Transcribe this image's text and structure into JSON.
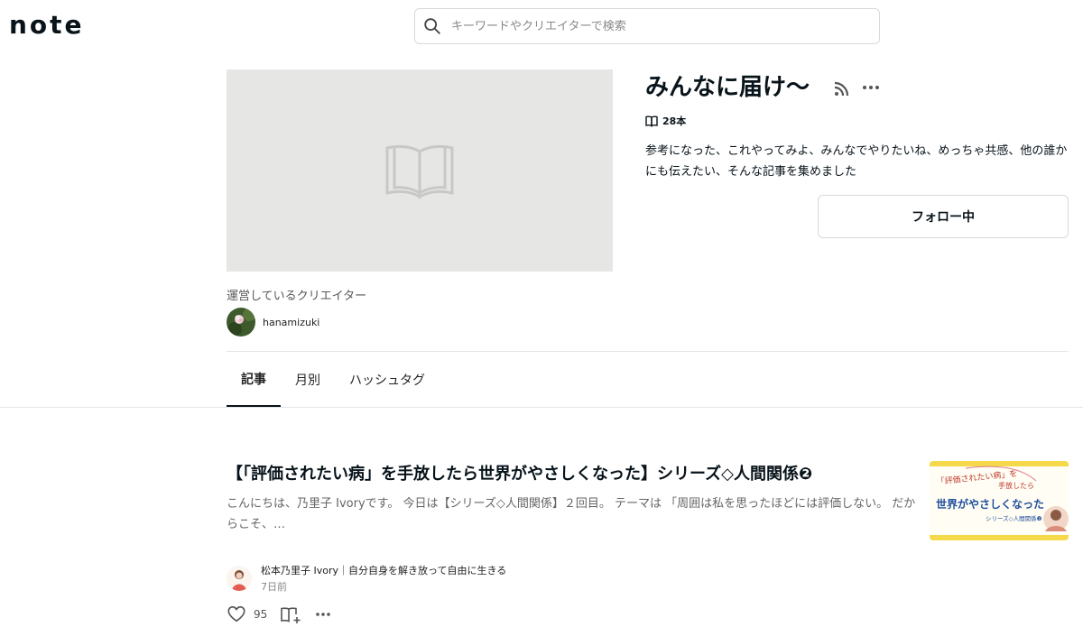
{
  "header": {
    "logo": "note",
    "search_placeholder": "キーワードやクリエイターで検索"
  },
  "magazine": {
    "title": "みんなに届け〜",
    "count": "28本",
    "description": "参考になった、これやってみよ、みんなでやりたいね、めっちゃ共感、他の誰かにも伝えたい、そんな記事を集めました",
    "follow_label": "フォロー中",
    "creators_label": "運営しているクリエイター",
    "creator_name": "hanamizuki"
  },
  "tabs": [
    {
      "label": "記事",
      "active": true
    },
    {
      "label": "月別",
      "active": false
    },
    {
      "label": "ハッシュタグ",
      "active": false
    }
  ],
  "article": {
    "title": "【「評価されたい病」を手放したら世界がやさしくなった】シリーズ◇人間関係❷",
    "excerpt": "こんにちは、乃里子 Ivoryです。 今日は【シリーズ◇人間関係】２回目。 テーマは 「周囲は私を思ったほどには評価しない。 だからこそ、…",
    "author_line": "松本乃里子 Ivory｜自分自身を解き放って自由に生きる",
    "time": "7日前",
    "likes": "95",
    "thumbnail": {
      "line1": "「評価されたい病」を",
      "line2": "手放したら",
      "line3": "世界がやさしくなった",
      "line4": "シリーズ◇人間関係❷"
    }
  },
  "colors": {
    "text": "#08131a",
    "border": "#d9d9d9",
    "cover_bg": "#e6e6e4",
    "thumb_yellow": "#f5d94a"
  }
}
